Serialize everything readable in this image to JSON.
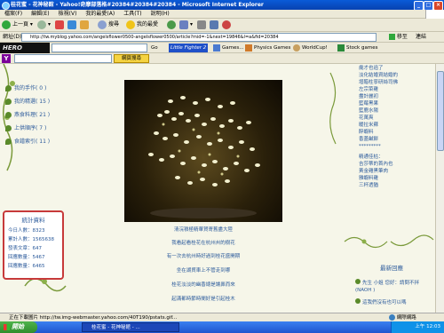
{
  "window": {
    "title": "桂花蜜 - 花神秘館 - Yahoo!奇摩部落格#20384#20384#20384 - Microsoft Internet Explorer"
  },
  "menu": [
    "檔案(F)",
    "編輯(E)",
    "檢視(V)",
    "我的最愛(A)",
    "工具(T)",
    "說明(H)"
  ],
  "toolbar": {
    "back": "上一頁",
    "search": "搜尋",
    "favorites": "我的最愛"
  },
  "address": {
    "label": "網址(D)",
    "url": "http://tw.myblog.yahoo.com/angelsflower0500-angelsflower0500/article?mid=-1&next=19846&l=a&fid=20384",
    "go": "移至",
    "links": "連結"
  },
  "links_bar": {
    "logo": "HERO FIGHTER",
    "go": "Go",
    "items": [
      "Little Fighter 2",
      "Games...",
      "Physics Games",
      "WorldCup!",
      "Stock games"
    ]
  },
  "yahoo_bar": {
    "logo": "Y",
    "button": "網頁搜尋"
  },
  "left_sidebar": {
    "categories": [
      {
        "label": "我的手作",
        "count": "( 0 )"
      },
      {
        "label": "我的精選",
        "count": "( 15 )"
      },
      {
        "label": "燕食料理",
        "count": "( 21 )"
      },
      {
        "label": "上供順序",
        "count": "( 7 )"
      },
      {
        "label": "食譜索引",
        "count": "( 11 )"
      }
    ],
    "stats": {
      "title": "統計資料",
      "rows": [
        "今日人數：8323",
        "累計人數：1565638",
        "發表文章：647",
        "回應數量：5467",
        "回應數量：6465"
      ]
    }
  },
  "article": {
    "lines": [
      "清浣積極精華賀寄舊盡大陸",
      "我看起看桂花在杭州州的樹花",
      "有一次去杭州時好過到桂花盛開期",
      "坐在湖貿車上不管走到哪",
      "桂花淡淡的幽香總是讓鼻而來",
      "起滿都時節時間好是引起桂木"
    ]
  },
  "right_sidebar": {
    "items": [
      "歲才也追了",
      "淡化結婚資結婚的",
      "增醋柱寧研絲司佛",
      "左宗菜雞",
      "盡計麗初",
      "藍莓黑果",
      "藍鹿水陽",
      "花萬爽",
      "暖拉米蘇",
      "醉蝦料",
      "香蓋鹹餅",
      "精通佳枯：",
      "吉莎蒂的首內也",
      "黃金雞黑筆肉",
      "雅蝦料雞",
      "三杯透猶"
    ],
    "separator": "*********",
    "latest": {
      "title": "最新回應",
      "items": [
        "先生 小姐 您好：請問不拌 (NAOH )",
        "這我們沒有也可以嗎"
      ]
    }
  },
  "status": {
    "text": "正在下載圖片 http://tw.img-webmaster.yahoo.com/40T190/pstats.gif...",
    "zone": "網際網路"
  },
  "taskbar": {
    "start": "開始",
    "task": "桂花蜜 - 花神秘館 - ...",
    "time": "上午 12:03"
  }
}
